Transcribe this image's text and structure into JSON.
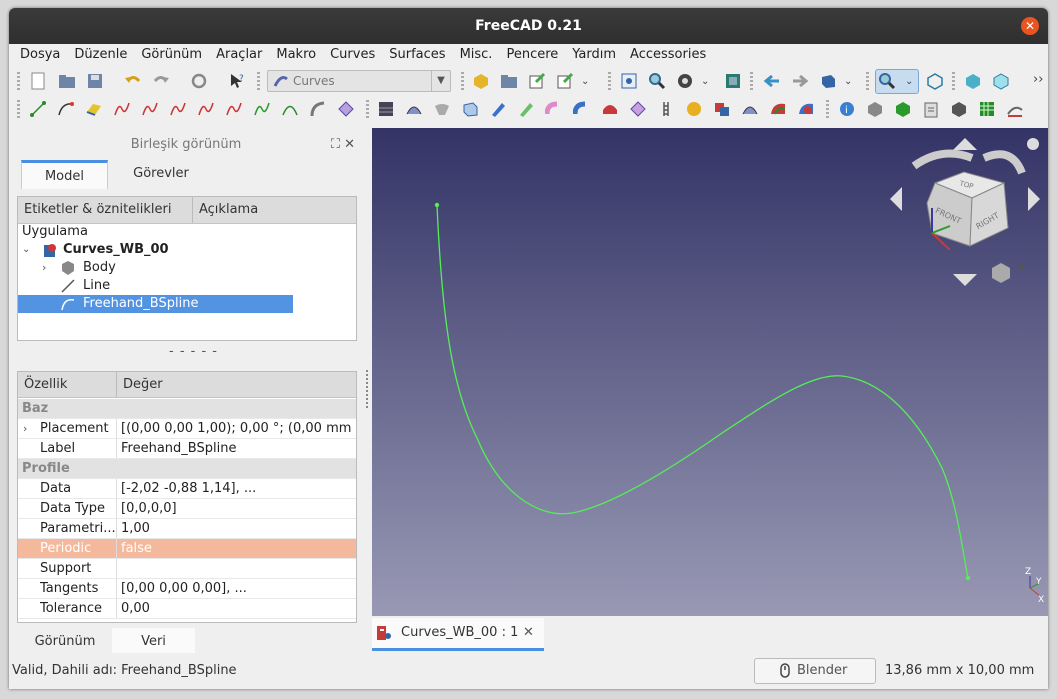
{
  "window": {
    "title": "FreeCAD 0.21",
    "close": "✕"
  },
  "menu": [
    "Dosya",
    "Düzenle",
    "Görünüm",
    "Araçlar",
    "Makro",
    "Curves",
    "Surfaces",
    "Misc.",
    "Pencere",
    "Yardım",
    "Accessories"
  ],
  "toolbar": {
    "workbench": "Curves",
    "overflow": "››"
  },
  "combo_panel": {
    "title": "Birleşik görünüm",
    "controls": "⛶ ✕"
  },
  "tabs": {
    "model": "Model",
    "tasks": "Görevler"
  },
  "tree": {
    "col_labels": "Etiketler & öznitelikleri",
    "col_desc": "Açıklama",
    "app_label": "Uygulama",
    "document": "Curves_WB_00",
    "items": [
      "Body",
      "Line",
      "Freehand_BSpline"
    ]
  },
  "properties": {
    "col_prop": "Özellik",
    "col_value": "Değer",
    "rows": [
      {
        "group": true,
        "k": "Baz"
      },
      {
        "k": "Placement",
        "v": "[(0,00 0,00 1,00); 0,00 °; (0,00 mm ...",
        "expand": true
      },
      {
        "k": "Label",
        "v": "Freehand_BSpline"
      },
      {
        "group": true,
        "k": "Profile"
      },
      {
        "k": "Data",
        "v": "[-2,02 -0,88 1,14], ..."
      },
      {
        "k": "Data Type",
        "v": "[0,0,0,0]"
      },
      {
        "k": "Parametri...",
        "v": "1,00"
      },
      {
        "k": "Periodic",
        "v": "false",
        "highlight": true
      },
      {
        "k": "Support",
        "v": ""
      },
      {
        "k": "Tangents",
        "v": "[0,00 0,00 0,00], ..."
      },
      {
        "k": "Tolerance",
        "v": "0,00"
      }
    ]
  },
  "bottom_tabs": {
    "view": "Görünüm",
    "data": "Veri"
  },
  "viewport": {
    "tab_label": "Curves_WB_00 : 1",
    "navcube": {
      "top": "TOP",
      "front": "FRONT",
      "right": "RIGHT"
    },
    "axes": {
      "x": "X",
      "y": "Y",
      "z": "Z"
    },
    "curve_color": "#55ee55"
  },
  "status": {
    "message": "Valid, Dahili adı: Freehand_BSpline",
    "nav_style": "Blender",
    "dimensions": "13,86 mm x 10,00 mm"
  }
}
